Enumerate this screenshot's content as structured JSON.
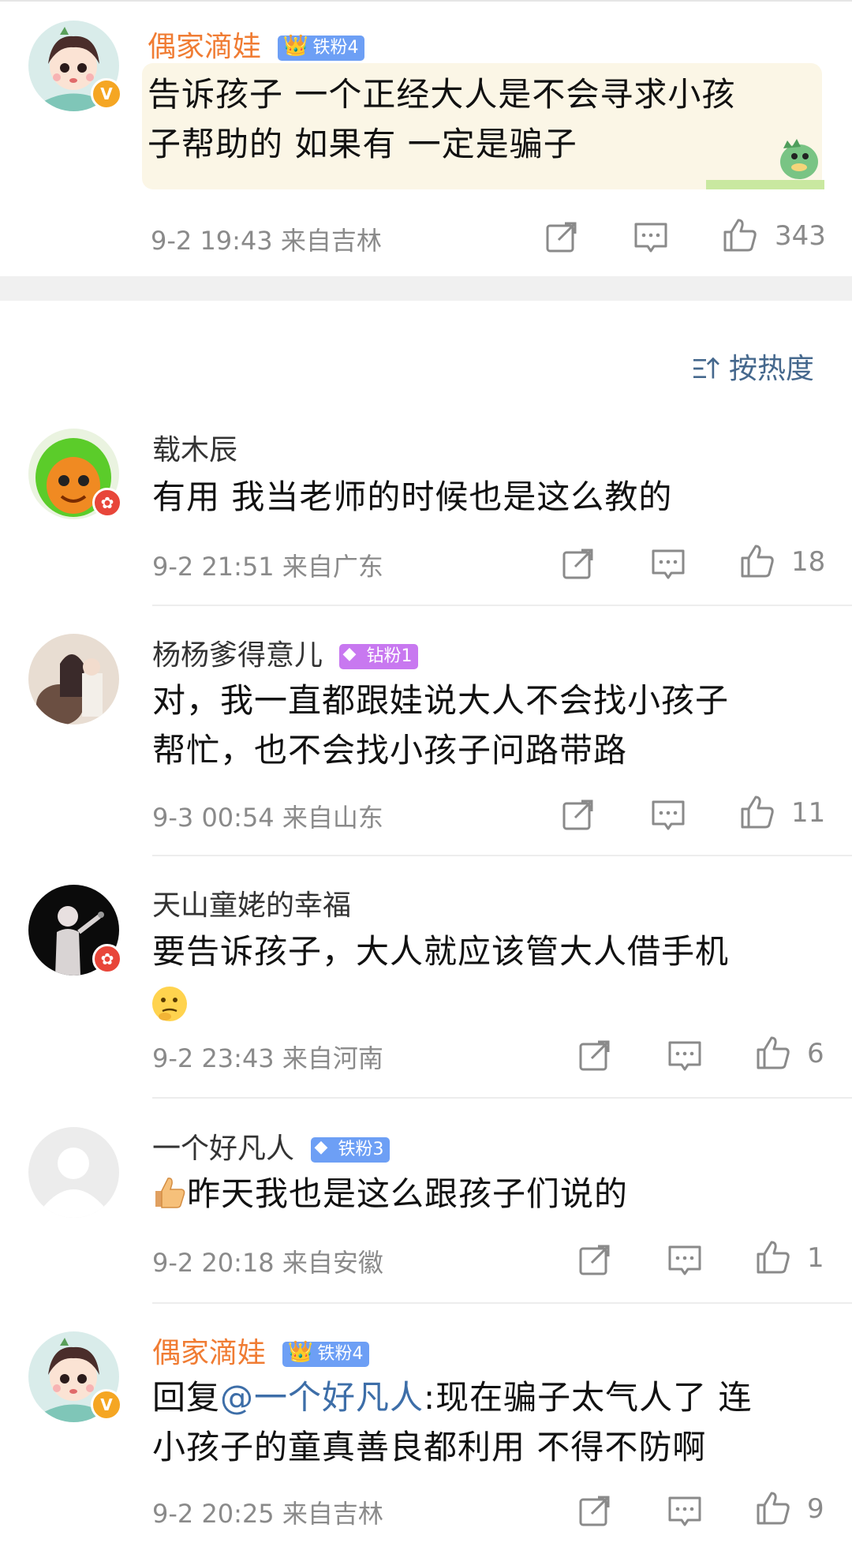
{
  "top_comment": {
    "username": "偶家滴娃",
    "badge": "铁粉4",
    "text_line1": "告诉孩子 一个正经大人是不会寻求小孩",
    "text_line2": "子帮助的 如果有 一定是骗子",
    "meta": "9-2 19:43 来自吉林",
    "likes": "343"
  },
  "sort": {
    "label": "按热度"
  },
  "replies": [
    {
      "username": "载木辰",
      "text_line1": "有用 我当老师的时候也是这么教的",
      "meta": "9-2 21:51 来自广东",
      "likes": "18"
    },
    {
      "username": "杨杨爹得意儿",
      "badge": "钻粉1",
      "text_line1": "对，我一直都跟娃说大人不会找小孩子",
      "text_line2": "帮忙，也不会找小孩子问路带路",
      "meta": "9-3 00:54 来自山东",
      "likes": "11"
    },
    {
      "username": "天山童姥的幸福",
      "text_line1": "要告诉孩子，大人就应该管大人借手机",
      "meta": "9-2 23:43 来自河南",
      "likes": "6"
    },
    {
      "username": "一个好凡人",
      "badge": "铁粉3",
      "text_line1": "昨天我也是这么跟孩子们说的",
      "meta": "9-2 20:18 来自安徽",
      "likes": "1"
    },
    {
      "username": "偶家滴娃",
      "badge": "铁粉4",
      "reply_prefix": "回复",
      "mention": "@一个好凡人",
      "text_line1_rest": ":现在骗子太气人了 连",
      "text_line2": "小孩子的童真善良都利用 不得不防啊",
      "meta": "9-2 20:25 来自吉林",
      "likes": "9"
    }
  ],
  "colors": {
    "orange_username": "#f07c33",
    "mention_blue": "#3d6ea8",
    "meta_gray": "#8a8a8a",
    "sort_blue": "#45688d"
  },
  "icons": [
    "share-icon",
    "comment-icon",
    "like-icon",
    "sort-icon"
  ]
}
